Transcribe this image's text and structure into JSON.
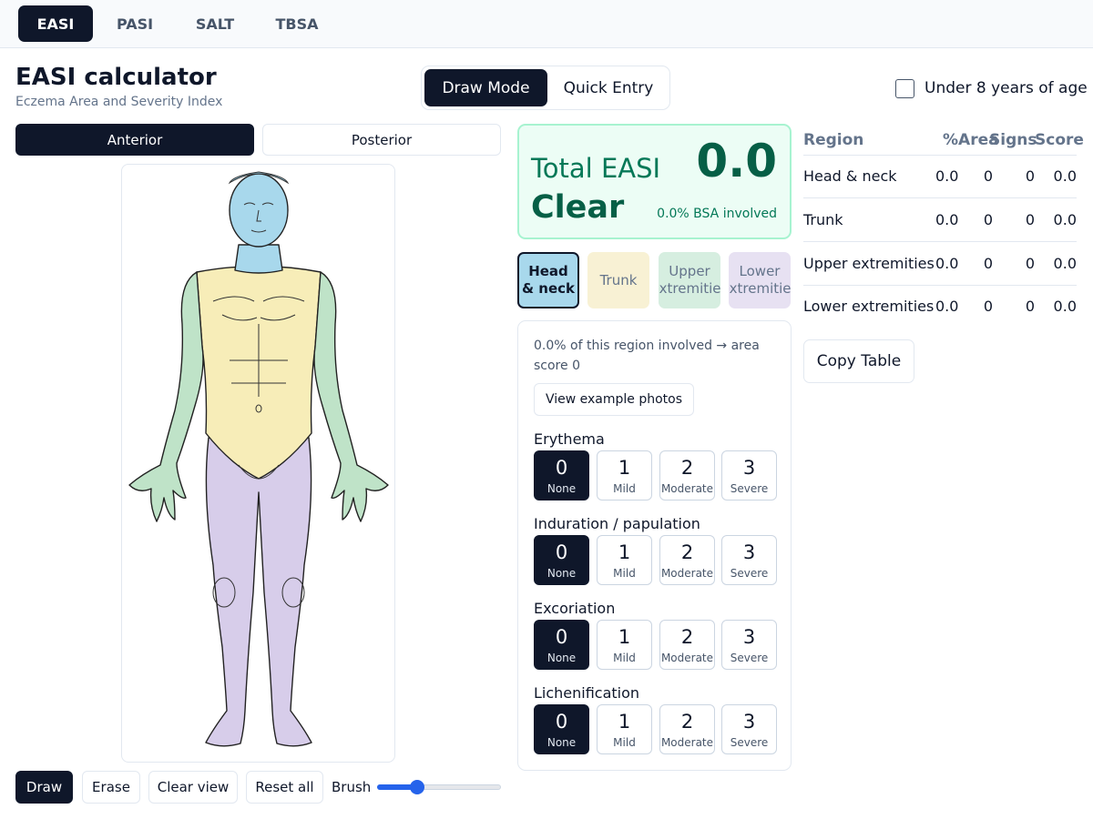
{
  "nav": {
    "tabs": [
      "EASI",
      "PASI",
      "SALT",
      "TBSA"
    ],
    "active": "EASI"
  },
  "header": {
    "title": "EASI calculator",
    "subtitle": "Eczema Area and Severity Index"
  },
  "mode": {
    "draw": "Draw Mode",
    "quick": "Quick Entry",
    "active": "Draw Mode"
  },
  "age_option": {
    "label": "Under 8 years of age",
    "checked": false
  },
  "view": {
    "anterior": "Anterior",
    "posterior": "Posterior",
    "active": "Anterior"
  },
  "tools": {
    "draw": "Draw",
    "erase": "Erase",
    "clear_view": "Clear view",
    "reset_all": "Reset all",
    "brush_label": "Brush",
    "brush_level": 0.3
  },
  "total": {
    "label": "Total EASI",
    "value": "0.0",
    "status": "Clear",
    "bsa": "0.0% BSA involved"
  },
  "region_tabs": [
    {
      "line1": "Head",
      "line2": "& neck",
      "color": "#a8d8ec"
    },
    {
      "line1": "Trunk",
      "line2": "",
      "color": "#f8f1d4"
    },
    {
      "line1": "Upper",
      "line2": "extremities",
      "color": "#d6eee0"
    },
    {
      "line1": "Lower",
      "line2": "extremities",
      "color": "#e7e1f2"
    }
  ],
  "region_panel": {
    "involved_text": "0.0% of this region involved → area score 0",
    "photos_button": "View example photos",
    "signs": [
      {
        "label": "Erythema",
        "selected": 0
      },
      {
        "label": "Induration / papulation",
        "selected": 0
      },
      {
        "label": "Excoriation",
        "selected": 0
      },
      {
        "label": "Lichenification",
        "selected": 0
      }
    ],
    "scores": [
      {
        "num": "0",
        "desc": "None"
      },
      {
        "num": "1",
        "desc": "Mild"
      },
      {
        "num": "2",
        "desc": "Moderate"
      },
      {
        "num": "3",
        "desc": "Severe"
      }
    ]
  },
  "table": {
    "headers": [
      "Region",
      "%Area",
      "Signs",
      "Score"
    ],
    "rows": [
      {
        "region": "Head & neck",
        "area": "0.0",
        "area_score": "0",
        "signs": "0",
        "score": "0.0"
      },
      {
        "region": "Trunk",
        "area": "0.0",
        "area_score": "0",
        "signs": "0",
        "score": "0.0"
      },
      {
        "region": "Upper extremities",
        "area": "0.0",
        "area_score": "0",
        "signs": "0",
        "score": "0.0"
      },
      {
        "region": "Lower extremities",
        "area": "0.0",
        "area_score": "0",
        "signs": "0",
        "score": "0.0"
      }
    ],
    "copy_button": "Copy Table"
  },
  "colors": {
    "head": "#a8d8ec",
    "trunk": "#f7edb8",
    "upper": "#bfe3c8",
    "lower": "#d7cdea",
    "dark": "#0f172a",
    "accent": "#2563eb"
  }
}
